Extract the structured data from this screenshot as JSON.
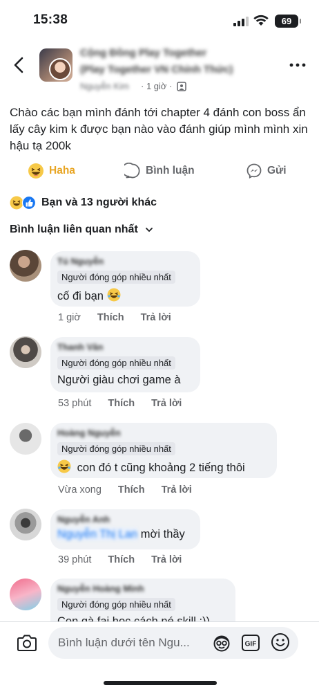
{
  "status_bar": {
    "time": "15:38",
    "battery": "69"
  },
  "header": {
    "group_name_line1": "Cộng Đồng Play Together",
    "group_name_line2": "(Play Together VN Chính Thức)",
    "author": "Nguyễn Kim",
    "time": "· 1 giờ ·"
  },
  "post": {
    "text": "Chào các bạn mình đánh tới chapter 4 đánh con boss ẩn lấy cây kim k được bạn nào vào đánh giúp mình mình xin hậu tạ 200k"
  },
  "actions": {
    "haha": "Haha",
    "comment": "Bình luận",
    "share": "Gửi"
  },
  "reactions": {
    "summary": "Bạn và 13 người khác"
  },
  "sort": {
    "label": "Bình luận liên quan nhất"
  },
  "comments": [
    {
      "name": "Tú Nguyễn",
      "badge": "Người đóng góp nhiều nhất",
      "text": "cố đi bạn",
      "emoji": "haha",
      "time": "1 giờ",
      "like": "Thích",
      "reply": "Trả lời"
    },
    {
      "name": "Thanh Vân",
      "badge": "Người đóng góp nhiều nhất",
      "text": "Người giàu chơi game à",
      "time": "53 phút",
      "like": "Thích",
      "reply": "Trả lời"
    },
    {
      "name": "Hoàng Nguyễn",
      "badge": "Người đóng góp nhiều nhất",
      "text": "con đó t cũng khoảng 2 tiếng thôi",
      "emoji_lead": "haha",
      "time": "Vừa xong",
      "like": "Thích",
      "reply": "Trả lời"
    },
    {
      "name": "Nguyễn Anh",
      "mention": "Nguyễn Thị Lan",
      "text": "mời thầy",
      "time": "39 phút",
      "like": "Thích",
      "reply": "Trả lời"
    },
    {
      "name": "Nguyễn Hoàng Minh",
      "badge": "Người đóng góp nhiều nhất",
      "text": "Con gà fai học cách né skill :))"
    }
  ],
  "composer": {
    "placeholder": "Bình luận dưới tên Ngu..."
  },
  "icons": {
    "back": "chevron-left-icon",
    "more": "more-dots-icon",
    "comment": "comment-bubble-icon",
    "share": "messenger-icon",
    "camera": "camera-icon",
    "gif": "gif-icon",
    "emoji": "smiley-icon"
  },
  "colors": {
    "haha": "#e8a523",
    "like_blue": "#1877f2",
    "muted": "#65676b",
    "bubble": "#f0f2f5"
  }
}
